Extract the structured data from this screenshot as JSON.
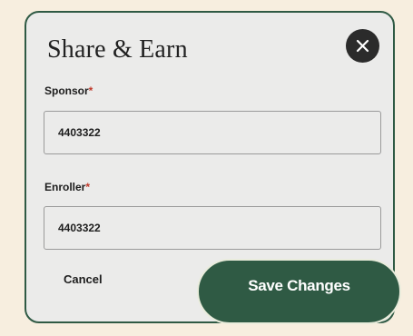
{
  "modal": {
    "title": "Share & Earn",
    "close_icon": "close-icon"
  },
  "fields": {
    "sponsor": {
      "label": "Sponsor",
      "required_mark": "*",
      "value": "4403322"
    },
    "enroller": {
      "label": "Enroller",
      "required_mark": "*",
      "value": "4403322"
    }
  },
  "actions": {
    "cancel_label": "Cancel",
    "save_label": "Save Changes"
  },
  "colors": {
    "page_background": "#f7eedf",
    "modal_background": "#ebebea",
    "brand_green": "#2f5a44",
    "close_button": "#2b2b2b",
    "required_mark": "#c0392b"
  }
}
